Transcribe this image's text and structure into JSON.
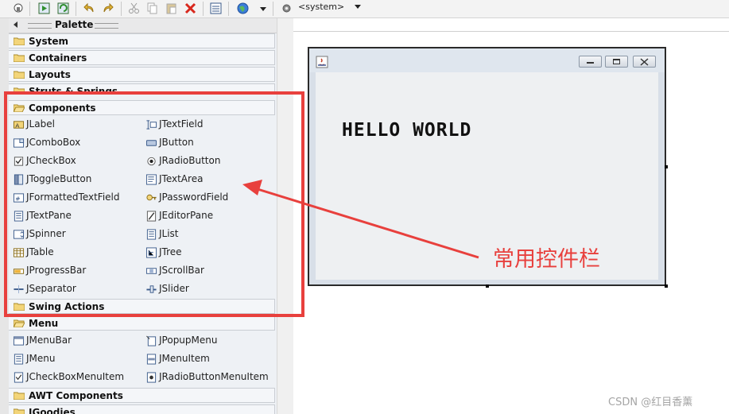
{
  "toolbar": {
    "buttons": [
      "navigator-icon",
      "design-icon",
      "refresh-icon",
      "undo-icon",
      "redo-icon",
      "cut-icon",
      "copy-icon",
      "paste-icon",
      "delete-icon",
      "properties-icon",
      "look-and-feel-icon",
      "dropdown-icon",
      "settings-icon"
    ],
    "laf_value": "<system>"
  },
  "palette": {
    "title": "Palette",
    "categories": {
      "system": "System",
      "containers": "Containers",
      "layouts": "Layouts",
      "struts": "Struts & Springs",
      "components": "Components",
      "swing_actions": "Swing Actions",
      "menu": "Menu",
      "awt": "AWT Components",
      "jgoodies": "JGoodies"
    },
    "components": [
      {
        "label": "JLabel",
        "icon": "label-icon"
      },
      {
        "label": "JTextField",
        "icon": "textfield-icon"
      },
      {
        "label": "JComboBox",
        "icon": "combobox-icon"
      },
      {
        "label": "JButton",
        "icon": "button-icon"
      },
      {
        "label": "JCheckBox",
        "icon": "checkbox-icon"
      },
      {
        "label": "JRadioButton",
        "icon": "radiobutton-icon"
      },
      {
        "label": "JToggleButton",
        "icon": "togglebutton-icon"
      },
      {
        "label": "JTextArea",
        "icon": "textarea-icon"
      },
      {
        "label": "JFormattedTextField",
        "icon": "formatted-textfield-icon"
      },
      {
        "label": "JPasswordField",
        "icon": "passwordfield-icon"
      },
      {
        "label": "JTextPane",
        "icon": "textpane-icon"
      },
      {
        "label": "JEditorPane",
        "icon": "editorpane-icon"
      },
      {
        "label": "JSpinner",
        "icon": "spinner-icon"
      },
      {
        "label": "JList",
        "icon": "list-icon"
      },
      {
        "label": "JTable",
        "icon": "table-icon"
      },
      {
        "label": "JTree",
        "icon": "tree-icon"
      },
      {
        "label": "JProgressBar",
        "icon": "progressbar-icon"
      },
      {
        "label": "JScrollBar",
        "icon": "scrollbar-icon"
      },
      {
        "label": "JSeparator",
        "icon": "separator-icon"
      },
      {
        "label": "JSlider",
        "icon": "slider-icon"
      }
    ],
    "menu_items": [
      {
        "label": "JMenuBar",
        "icon": "menubar-icon"
      },
      {
        "label": "JPopupMenu",
        "icon": "popupmenu-icon"
      },
      {
        "label": "JMenu",
        "icon": "menu-icon"
      },
      {
        "label": "JMenuItem",
        "icon": "menuitem-icon"
      },
      {
        "label": "JCheckBoxMenuItem",
        "icon": "checkbox-menuitem-icon"
      },
      {
        "label": "JRadioButtonMenuItem",
        "icon": "radio-menuitem-icon"
      }
    ]
  },
  "design": {
    "label_text": "HELLO WORLD",
    "window_buttons": [
      "minimize-icon",
      "maximize-icon",
      "close-icon"
    ]
  },
  "annotation": {
    "text": "常用控件栏",
    "color": "#e8403d"
  },
  "watermark": "CSDN @红目香薰"
}
